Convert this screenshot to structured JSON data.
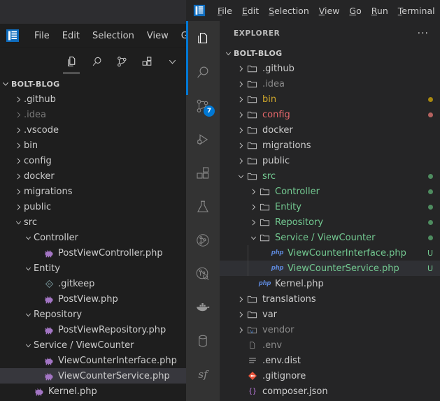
{
  "left_window": {
    "menu": {
      "items": [
        "File",
        "Edit",
        "Selection",
        "View",
        "Go"
      ]
    },
    "activity_icons": [
      "explorer-icon",
      "search-icon",
      "source-control-icon",
      "extensions-icon",
      "chevron-down-icon"
    ],
    "tree": {
      "root": "BOLT-BLOG",
      "items": [
        {
          "label": ".github",
          "indent": 1,
          "type": "folder",
          "state": "collapsed",
          "dim": false,
          "selected": false
        },
        {
          "label": ".idea",
          "indent": 1,
          "type": "folder",
          "state": "collapsed",
          "dim": true,
          "selected": false
        },
        {
          "label": ".vscode",
          "indent": 1,
          "type": "folder",
          "state": "collapsed",
          "dim": false,
          "selected": false
        },
        {
          "label": "bin",
          "indent": 1,
          "type": "folder",
          "state": "collapsed",
          "dim": false,
          "selected": false
        },
        {
          "label": "config",
          "indent": 1,
          "type": "folder",
          "state": "collapsed",
          "dim": false,
          "selected": false
        },
        {
          "label": "docker",
          "indent": 1,
          "type": "folder",
          "state": "collapsed",
          "dim": false,
          "selected": false
        },
        {
          "label": "migrations",
          "indent": 1,
          "type": "folder",
          "state": "collapsed",
          "dim": false,
          "selected": false
        },
        {
          "label": "public",
          "indent": 1,
          "type": "folder",
          "state": "collapsed",
          "dim": false,
          "selected": false
        },
        {
          "label": "src",
          "indent": 1,
          "type": "folder",
          "state": "expanded",
          "dim": false,
          "selected": false
        },
        {
          "label": "Controller",
          "indent": 2,
          "type": "folder",
          "state": "expanded",
          "dim": false,
          "selected": false
        },
        {
          "label": "PostViewController.php",
          "indent": 3,
          "type": "php",
          "state": "file",
          "dim": false,
          "selected": false
        },
        {
          "label": "Entity",
          "indent": 2,
          "type": "folder",
          "state": "expanded",
          "dim": false,
          "selected": false
        },
        {
          "label": ".gitkeep",
          "indent": 3,
          "type": "git",
          "state": "file",
          "dim": false,
          "selected": false
        },
        {
          "label": "PostView.php",
          "indent": 3,
          "type": "php",
          "state": "file",
          "dim": false,
          "selected": false
        },
        {
          "label": "Repository",
          "indent": 2,
          "type": "folder",
          "state": "expanded",
          "dim": false,
          "selected": false
        },
        {
          "label": "PostViewRepository.php",
          "indent": 3,
          "type": "php",
          "state": "file",
          "dim": false,
          "selected": false
        },
        {
          "label": "Service / ViewCounter",
          "indent": 2,
          "type": "folder",
          "state": "expanded",
          "dim": false,
          "selected": false
        },
        {
          "label": "ViewCounterInterface.php",
          "indent": 3,
          "type": "php",
          "state": "file",
          "dim": false,
          "selected": false
        },
        {
          "label": "ViewCounterService.php",
          "indent": 3,
          "type": "php",
          "state": "file",
          "dim": false,
          "selected": true
        },
        {
          "label": "Kernel.php",
          "indent": 2,
          "type": "php",
          "state": "file",
          "dim": false,
          "selected": false
        }
      ]
    }
  },
  "right_window": {
    "menu": {
      "items": [
        {
          "label": "File",
          "accel": "F"
        },
        {
          "label": "Edit",
          "accel": "E"
        },
        {
          "label": "Selection",
          "accel": "S"
        },
        {
          "label": "View",
          "accel": "V"
        },
        {
          "label": "Go",
          "accel": "G"
        },
        {
          "label": "Run",
          "accel": "R"
        },
        {
          "label": "Terminal",
          "accel": "T"
        }
      ]
    },
    "activity_bar": {
      "items": [
        {
          "name": "explorer-icon",
          "active": true,
          "badge": ""
        },
        {
          "name": "search-icon",
          "active": false,
          "badge": ""
        },
        {
          "name": "source-control-icon",
          "active": false,
          "badge": "7"
        },
        {
          "name": "run-and-debug-icon",
          "active": false,
          "badge": ""
        },
        {
          "name": "extensions-icon",
          "active": false,
          "badge": ""
        },
        {
          "name": "testing-flask-icon",
          "active": false,
          "badge": ""
        },
        {
          "name": "git-graph-icon",
          "active": false,
          "badge": ""
        },
        {
          "name": "git-graph-search-icon",
          "active": false,
          "badge": ""
        },
        {
          "name": "docker-whale-icon",
          "active": false,
          "badge": ""
        },
        {
          "name": "database-icon",
          "active": false,
          "badge": ""
        },
        {
          "name": "symfony-icon",
          "active": false,
          "badge": ""
        }
      ]
    },
    "sidebar": {
      "title": "EXPLORER",
      "more_actions": "···",
      "tree": {
        "root": "BOLT-BLOG",
        "items": [
          {
            "label": ".github",
            "indent": 1,
            "type": "folder",
            "state": "collapsed",
            "color": "#cccccc",
            "deco": "",
            "dot": "",
            "selected": false
          },
          {
            "label": ".idea",
            "indent": 1,
            "type": "folder",
            "state": "collapsed",
            "color": "#8b8b8b",
            "deco": "",
            "dot": "",
            "selected": false
          },
          {
            "label": "bin",
            "indent": 1,
            "type": "folder",
            "state": "collapsed",
            "color": "#cfa72c",
            "deco": "",
            "dot": "#a8880f",
            "selected": false
          },
          {
            "label": "config",
            "indent": 1,
            "type": "folder",
            "state": "collapsed",
            "color": "#e4676b",
            "deco": "",
            "dot": "#b5625f",
            "selected": false
          },
          {
            "label": "docker",
            "indent": 1,
            "type": "folder",
            "state": "collapsed",
            "color": "#cccccc",
            "deco": "",
            "dot": "",
            "selected": false
          },
          {
            "label": "migrations",
            "indent": 1,
            "type": "folder",
            "state": "collapsed",
            "color": "#cccccc",
            "deco": "",
            "dot": "",
            "selected": false
          },
          {
            "label": "public",
            "indent": 1,
            "type": "folder",
            "state": "collapsed",
            "color": "#cccccc",
            "deco": "",
            "dot": "",
            "selected": false
          },
          {
            "label": "src",
            "indent": 1,
            "type": "folder",
            "state": "expanded",
            "color": "#73c991",
            "deco": "",
            "dot": "#4e8c5f",
            "selected": false
          },
          {
            "label": "Controller",
            "indent": 2,
            "type": "folder",
            "state": "collapsed",
            "color": "#73c991",
            "deco": "",
            "dot": "#4e8c5f",
            "selected": false
          },
          {
            "label": "Entity",
            "indent": 2,
            "type": "folder",
            "state": "collapsed",
            "color": "#73c991",
            "deco": "",
            "dot": "#4e8c5f",
            "selected": false
          },
          {
            "label": "Repository",
            "indent": 2,
            "type": "folder",
            "state": "collapsed",
            "color": "#73c991",
            "deco": "",
            "dot": "#4e8c5f",
            "selected": false
          },
          {
            "label": "Service / ViewCounter",
            "indent": 2,
            "type": "folder",
            "state": "expanded",
            "color": "#73c991",
            "deco": "",
            "dot": "#4e8c5f",
            "selected": false
          },
          {
            "label": "ViewCounterInterface.php",
            "indent": 3,
            "type": "php",
            "state": "file",
            "color": "#73c991",
            "deco": "U",
            "dot": "",
            "selected": false
          },
          {
            "label": "ViewCounterService.php",
            "indent": 3,
            "type": "php",
            "state": "file",
            "color": "#73c991",
            "deco": "U",
            "dot": "",
            "selected": true
          },
          {
            "label": "Kernel.php",
            "indent": 2,
            "type": "php",
            "state": "file",
            "color": "#cccccc",
            "deco": "",
            "dot": "",
            "selected": false
          },
          {
            "label": "translations",
            "indent": 1,
            "type": "folder",
            "state": "collapsed",
            "color": "#cccccc",
            "deco": "",
            "dot": "",
            "selected": false
          },
          {
            "label": "var",
            "indent": 1,
            "type": "folder",
            "state": "collapsed",
            "color": "#cccccc",
            "deco": "",
            "dot": "",
            "selected": false
          },
          {
            "label": "vendor",
            "indent": 1,
            "type": "folder",
            "state": "collapsed",
            "color": "#8b8b8b",
            "deco": "",
            "dot": "",
            "selected": false
          },
          {
            "label": ".env",
            "indent": 1,
            "type": "env",
            "state": "file",
            "color": "#8b8b8b",
            "deco": "",
            "dot": "",
            "selected": false
          },
          {
            "label": ".env.dist",
            "indent": 1,
            "type": "lines",
            "state": "file",
            "color": "#cccccc",
            "deco": "",
            "dot": "",
            "selected": false
          },
          {
            "label": ".gitignore",
            "indent": 1,
            "type": "git",
            "state": "file",
            "color": "#cccccc",
            "deco": "",
            "dot": "",
            "selected": false
          },
          {
            "label": "composer.json",
            "indent": 1,
            "type": "json",
            "state": "file",
            "color": "#cccccc",
            "deco": "",
            "dot": "",
            "selected": false
          }
        ]
      }
    }
  },
  "colors": {
    "accent": "#0078d4",
    "git_untracked": "#73c991",
    "git_modified": "#cfa72c",
    "git_conflict": "#e4676b",
    "selection": "#37373d",
    "sidebar_bg": "#252526",
    "activitybar_bg": "#333333"
  }
}
